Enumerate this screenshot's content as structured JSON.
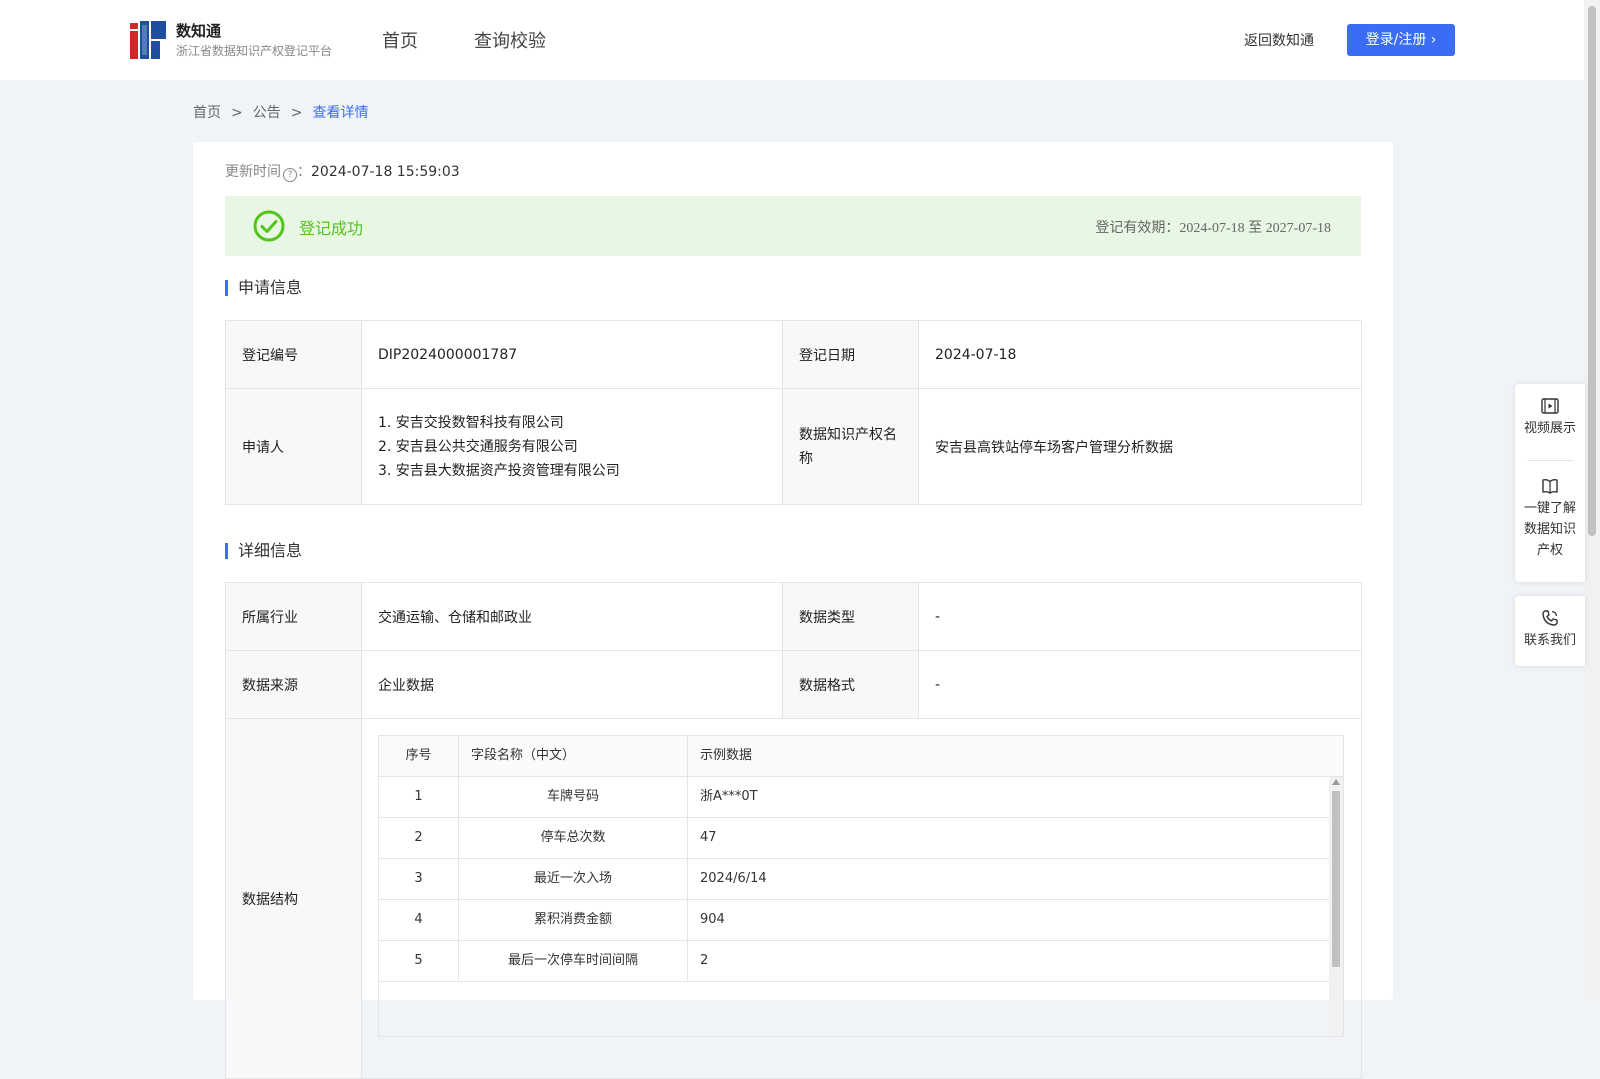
{
  "brand": {
    "name": "数知通",
    "subtitle": "浙江省数据知识产权登记平台"
  },
  "nav": {
    "home": "首页",
    "query": "查询校验"
  },
  "header": {
    "back": "返回数知通",
    "login": "登录/注册 ›"
  },
  "breadcrumb": {
    "home": "首页",
    "sep": ">",
    "notice": "公告",
    "current": "查看详情"
  },
  "update": {
    "label": "更新时间",
    "help": "?",
    "colon": "：",
    "value": "2024-07-18 15:59:03"
  },
  "status": {
    "text": "登记成功",
    "validity_label": "登记有效期：",
    "validity_value": "2024-07-18 至 2027-07-18"
  },
  "colors": {
    "accent": "#3a6cf4",
    "success": "#52c41a",
    "success_bg": "#e8f7e4"
  },
  "sections": {
    "apply": "申请信息",
    "detail": "详细信息"
  },
  "apply": {
    "reg_no_label": "登记编号",
    "reg_no": "DIP2024000001787",
    "reg_date_label": "登记日期",
    "reg_date": "2024-07-18",
    "applicant_label": "申请人",
    "applicants": [
      "1. 安吉交投数智科技有限公司",
      "2. 安吉县公共交通服务有限公司",
      "3. 安吉县大数据资产投资管理有限公司"
    ],
    "ip_name_label": "数据知识产权名称",
    "ip_name": "安吉县高铁站停车场客户管理分析数据"
  },
  "detail": {
    "industry_label": "所属行业",
    "industry": "交通运输、仓储和邮政业",
    "data_type_label": "数据类型",
    "data_type": "-",
    "source_label": "数据来源",
    "source": "企业数据",
    "format_label": "数据格式",
    "format": "-",
    "structure_label": "数据结构",
    "structure_headers": [
      "序号",
      "字段名称（中文）",
      "示例数据"
    ],
    "structure_rows": [
      [
        "1",
        "车牌号码",
        "浙A***0T"
      ],
      [
        "2",
        "停车总次数",
        "47"
      ],
      [
        "3",
        "最近一次入场",
        "2024/6/14"
      ],
      [
        "4",
        "累积消费金额",
        "904"
      ],
      [
        "5",
        "最后一次停车时间间隔",
        "2"
      ]
    ]
  },
  "side": {
    "video": "视频展示",
    "learn": "一键了解数据知识产权",
    "contact": "联系我们"
  }
}
